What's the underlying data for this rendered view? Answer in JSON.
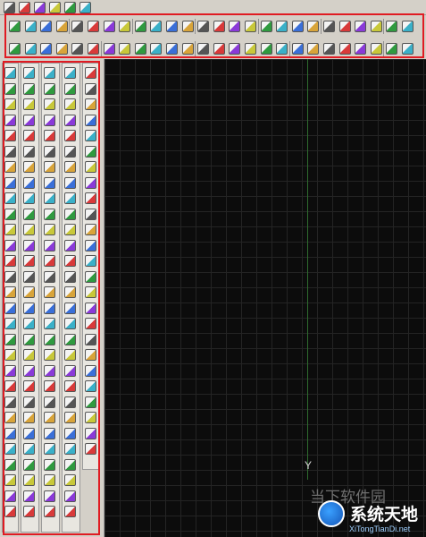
{
  "colors": {
    "highlight_box": "#e01b22",
    "canvas_bg": "#0c0c0c",
    "grid": "#242424",
    "y_axis": "#2e6b2e",
    "toolbar_bg": "#d4d0c8"
  },
  "drawing_area": {
    "axis_label": "Y"
  },
  "watermark": {
    "faded_text": "当下软件园",
    "brand_text": "系统天地",
    "brand_url": "XiTongTianDi.net"
  }
}
